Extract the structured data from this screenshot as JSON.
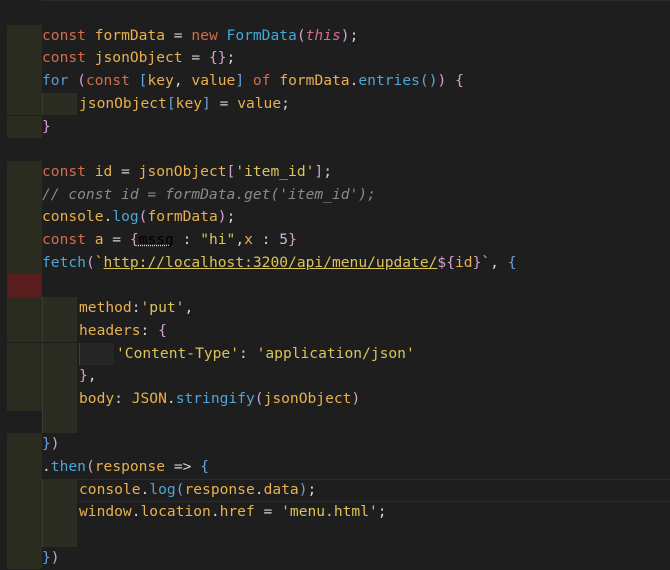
{
  "editor": {
    "lines": [
      {
        "tokens": []
      },
      {
        "tokens": [
          [
            "kw",
            "const "
          ],
          [
            "var",
            "formData"
          ],
          [
            "op",
            " = "
          ],
          [
            "kw",
            "new "
          ],
          [
            "cls",
            "FormData"
          ],
          [
            "p1",
            "("
          ],
          [
            "this",
            "this"
          ],
          [
            "p1",
            ")"
          ],
          [
            "plain",
            ";"
          ]
        ]
      },
      {
        "tokens": [
          [
            "kw",
            "const "
          ],
          [
            "var",
            "jsonObject"
          ],
          [
            "op",
            " = "
          ],
          [
            "p1",
            "{}"
          ],
          [
            "plain",
            ";"
          ]
        ]
      },
      {
        "tokens": [
          [
            "key",
            "for "
          ],
          [
            "p1",
            "("
          ],
          [
            "kw",
            "const "
          ],
          [
            "p2",
            "["
          ],
          [
            "var",
            "key"
          ],
          [
            "plain",
            ", "
          ],
          [
            "var",
            "value"
          ],
          [
            "p2",
            "]"
          ],
          [
            "kw",
            " of "
          ],
          [
            "var",
            "formData"
          ],
          [
            "plain",
            "."
          ],
          [
            "fn",
            "entries"
          ],
          [
            "p2",
            "()"
          ],
          [
            "p1",
            ")"
          ],
          [
            "plain",
            " "
          ],
          [
            "p1",
            "{"
          ]
        ]
      },
      {
        "indent": 1,
        "tokens": [
          [
            "var",
            "jsonObject"
          ],
          [
            "p2",
            "["
          ],
          [
            "var",
            "key"
          ],
          [
            "p2",
            "]"
          ],
          [
            "op",
            " = "
          ],
          [
            "var",
            "value"
          ],
          [
            "plain",
            ";"
          ]
        ]
      },
      {
        "tokens": [
          [
            "p1",
            "}"
          ]
        ]
      },
      {
        "tokens": []
      },
      {
        "tokens": [
          [
            "kw",
            "const "
          ],
          [
            "var",
            "id"
          ],
          [
            "op",
            " = "
          ],
          [
            "var",
            "jsonObject"
          ],
          [
            "p1",
            "["
          ],
          [
            "str",
            "'item_id'"
          ],
          [
            "p1",
            "]"
          ],
          [
            "plain",
            ";"
          ]
        ]
      },
      {
        "tokens": [
          [
            "cmt",
            "// const id = formData.get('item_id');"
          ]
        ]
      },
      {
        "tokens": [
          [
            "var",
            "console"
          ],
          [
            "plain",
            "."
          ],
          [
            "fn",
            "log"
          ],
          [
            "p1",
            "("
          ],
          [
            "var",
            "formData"
          ],
          [
            "p1",
            ")"
          ],
          [
            "plain",
            ";"
          ]
        ]
      },
      {
        "tokens": [
          [
            "kw",
            "const "
          ],
          [
            "var",
            "a"
          ],
          [
            "op",
            " = "
          ],
          [
            "p1",
            "{"
          ],
          [
            "sq",
            "mssg"
          ],
          [
            "plain",
            " : "
          ],
          [
            "str",
            "\"hi\""
          ],
          [
            "plain",
            ","
          ],
          [
            "var",
            "x"
          ],
          [
            "plain",
            " : "
          ],
          [
            "num",
            "5"
          ],
          [
            "p1",
            "}"
          ]
        ]
      },
      {
        "tokens": [
          [
            "fn",
            "fetch"
          ],
          [
            "p1",
            "("
          ],
          [
            "str",
            "`"
          ],
          [
            "url",
            "http://localhost:3200/api/menu/update/"
          ],
          [
            "p1",
            "${"
          ],
          [
            "var",
            "id"
          ],
          [
            "p1",
            "}"
          ],
          [
            "str",
            "`"
          ],
          [
            "plain",
            ", "
          ],
          [
            "p2",
            "{"
          ]
        ]
      },
      {
        "error": true,
        "tokens": []
      },
      {
        "indent": 1,
        "tokens": [
          [
            "prop",
            "method"
          ],
          [
            "plain",
            ":"
          ],
          [
            "str",
            "'put'"
          ],
          [
            "plain",
            ","
          ]
        ]
      },
      {
        "indent": 1,
        "tokens": [
          [
            "prop",
            "headers"
          ],
          [
            "plain",
            ": "
          ],
          [
            "p1",
            "{"
          ]
        ]
      },
      {
        "indent": 2,
        "tokens": [
          [
            "str",
            "'Content-Type'"
          ],
          [
            "plain",
            ": "
          ],
          [
            "str",
            "'application/json'"
          ]
        ]
      },
      {
        "indent": 1,
        "tokens": [
          [
            "p1",
            "}"
          ],
          [
            "plain",
            ","
          ]
        ]
      },
      {
        "indent": 1,
        "tokens": [
          [
            "prop",
            "body"
          ],
          [
            "plain",
            ": "
          ],
          [
            "var",
            "JSON"
          ],
          [
            "plain",
            "."
          ],
          [
            "fn",
            "stringify"
          ],
          [
            "p1",
            "("
          ],
          [
            "var",
            "jsonObject"
          ],
          [
            "p1",
            ")"
          ]
        ]
      },
      {
        "indent": 1,
        "tokens": []
      },
      {
        "tokens": [
          [
            "p2",
            "}"
          ],
          [
            "p1",
            ")"
          ]
        ]
      },
      {
        "tokens": [
          [
            "plain",
            "."
          ],
          [
            "fn",
            "then"
          ],
          [
            "p1",
            "("
          ],
          [
            "var",
            "response"
          ],
          [
            "op",
            " => "
          ],
          [
            "p2",
            "{"
          ]
        ]
      },
      {
        "indent": 1,
        "current": true,
        "tokens": [
          [
            "var",
            "console"
          ],
          [
            "plain",
            "."
          ],
          [
            "fn",
            "log"
          ],
          [
            "p2",
            "("
          ],
          [
            "var",
            "response"
          ],
          [
            "plain",
            "."
          ],
          [
            "var",
            "data"
          ],
          [
            "p2",
            ")"
          ],
          [
            "plain",
            ";"
          ]
        ]
      },
      {
        "indent": 1,
        "tokens": [
          [
            "var",
            "window"
          ],
          [
            "plain",
            "."
          ],
          [
            "var",
            "location"
          ],
          [
            "plain",
            "."
          ],
          [
            "var",
            "href"
          ],
          [
            "op",
            " = "
          ],
          [
            "str",
            "'menu.html'"
          ],
          [
            "plain",
            ";"
          ]
        ]
      },
      {
        "indent": 1,
        "tokens": []
      },
      {
        "tokens": [
          [
            "p2",
            "}"
          ],
          [
            "p1",
            ")"
          ]
        ]
      }
    ]
  },
  "colors": {
    "background": "#1e1e1e",
    "keyword": "#d66b4a",
    "string": "#dcc35a",
    "function": "#4ea6d6",
    "error_gutter": "#5a1d1d"
  }
}
